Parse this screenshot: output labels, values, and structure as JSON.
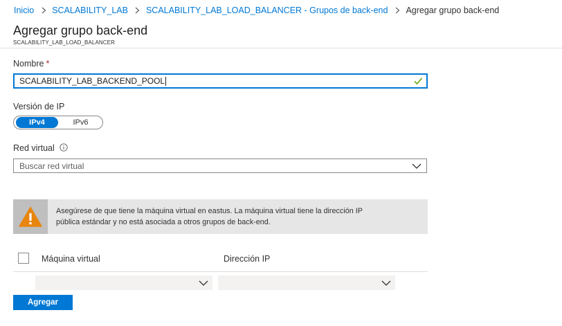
{
  "breadcrumb": {
    "items": [
      "Inicio",
      "SCALABILITY_LAB",
      "SCALABILITY_LAB_LOAD_BALANCER - Grupos de back-end"
    ],
    "current": "Agregar grupo back-end"
  },
  "header": {
    "title": "Agregar grupo back-end",
    "subtitle": "SCALABILITY_LAB_LOAD_BALANCER"
  },
  "form": {
    "name": {
      "label": "Nombre",
      "required_mark": "*",
      "value": "SCALABILITY_LAB_BACKEND_POOL"
    },
    "ip_version": {
      "label": "Versión de IP",
      "options": [
        "IPv4",
        "IPv6"
      ],
      "selected": "IPv4"
    },
    "virtual_network": {
      "label": "Red virtual",
      "placeholder": "Buscar red virtual"
    },
    "warning": {
      "line1": "Asegúrese de que tiene la máquina virtual en eastus. La máquina virtual tiene la dirección IP",
      "line2": "pública estándar y no está asociada a otros grupos de back-end."
    },
    "table": {
      "columns": [
        "Máquina virtual",
        "Dirección IP"
      ]
    },
    "submit_label": "Agregar"
  },
  "colors": {
    "accent": "#0078d4",
    "success_check": "#57a300",
    "warning_icon": "#e8850f",
    "required": "#a4262c"
  }
}
